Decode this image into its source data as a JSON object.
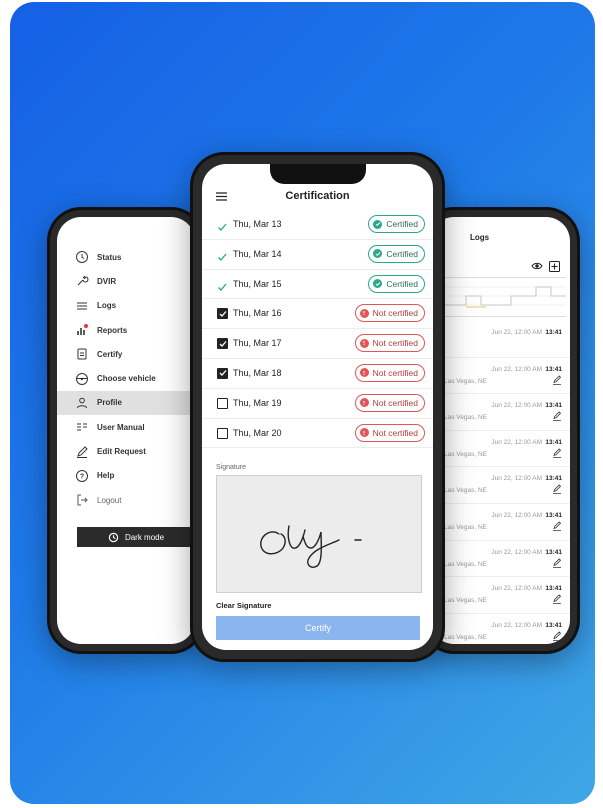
{
  "left_phone": {
    "menu": [
      {
        "label": "Status",
        "icon": "clock-icon"
      },
      {
        "label": "DVIR",
        "icon": "wrench-icon"
      },
      {
        "label": "Logs",
        "icon": "lines-icon"
      },
      {
        "label": "Reports",
        "icon": "bar-chart-icon"
      },
      {
        "label": "Certify",
        "icon": "document-icon"
      },
      {
        "label": "Choose vehicle",
        "icon": "steering-wheel-icon"
      },
      {
        "label": "Profile",
        "icon": "user-icon",
        "active": true
      },
      {
        "label": "User Manual",
        "icon": "manual-icon"
      },
      {
        "label": "Edit Request",
        "icon": "pencil-icon"
      },
      {
        "label": "Help",
        "icon": "help-icon"
      },
      {
        "label": "Logout",
        "icon": "logout-icon"
      }
    ],
    "dark_mode_label": "Dark mode"
  },
  "center_phone": {
    "title": "Certification",
    "days": [
      {
        "label": "Thu, Mar 13",
        "status": "Certified",
        "certified": true
      },
      {
        "label": "Thu, Mar 14",
        "status": "Certified",
        "certified": true
      },
      {
        "label": "Thu, Mar 15",
        "status": "Certified",
        "certified": true
      },
      {
        "label": "Thu, Mar 16",
        "status": "Not certified",
        "certified": false,
        "checked": true
      },
      {
        "label": "Thu, Mar 17",
        "status": "Not certified",
        "certified": false,
        "checked": true
      },
      {
        "label": "Thu, Mar 18",
        "status": "Not certified",
        "certified": false,
        "checked": true
      },
      {
        "label": "Thu, Mar 19",
        "status": "Not certified",
        "certified": false,
        "checked": false
      },
      {
        "label": "Thu, Mar 20",
        "status": "Not certified",
        "certified": false,
        "checked": false
      }
    ],
    "signature_label": "Signature",
    "clear_signature_label": "Clear Signature",
    "certify_label": "Certify"
  },
  "right_phone": {
    "title": "Logs",
    "rows": [
      {
        "date": "Jun 22, 12:00 AM",
        "time": "13:41",
        "location": ""
      },
      {
        "date": "Jun 22, 12:00 AM",
        "time": "13:41",
        "location": "Las Vegas, NE"
      },
      {
        "date": "Jun 22, 12:00 AM",
        "time": "13:41",
        "location": "Las Vegas, NE"
      },
      {
        "date": "Jun 22, 12:00 AM",
        "time": "13:41",
        "location": "Las Vegas, NE"
      },
      {
        "date": "Jun 22, 12:00 AM",
        "time": "13:41",
        "location": "Las Vegas, NE"
      },
      {
        "date": "Jun 22, 12:00 AM",
        "time": "13:41",
        "location": "Las Vegas, NE"
      },
      {
        "date": "Jun 22, 12:00 AM",
        "time": "13:41",
        "location": "Las Vegas, NE"
      },
      {
        "date": "Jun 22, 12:00 AM",
        "time": "13:41",
        "location": "Las Vegas, NE"
      },
      {
        "date": "Jun 22, 12:00 AM",
        "time": "13:41",
        "location": "Las Vegas, NE"
      }
    ]
  },
  "colors": {
    "background_start": "#1560e6",
    "background_end": "#3fa7e6",
    "certified": "#2aa88a",
    "not_certified": "#e05555",
    "certify_button": "#8ab5ef"
  }
}
